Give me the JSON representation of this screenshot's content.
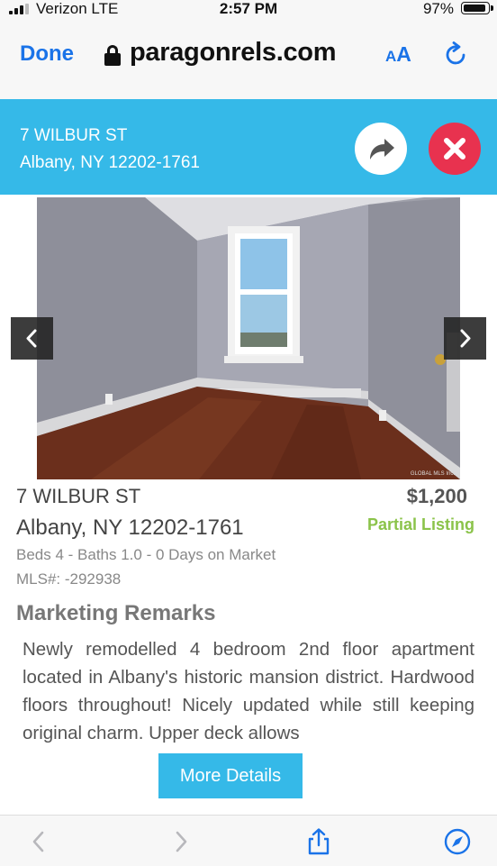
{
  "status_bar": {
    "carrier": "Verizon  LTE",
    "time": "2:57 PM",
    "battery": "97%",
    "battery_level": 0.97
  },
  "browser": {
    "done_label": "Done",
    "domain": "paragonrels.com",
    "text_size_small": "A",
    "text_size_large": "A"
  },
  "header": {
    "street": "7 WILBUR ST",
    "city_line": "Albany, NY 12202-1761"
  },
  "photo": {
    "watermark": "GLOBAL MLS Inc."
  },
  "listing": {
    "street": "7 WILBUR ST",
    "city_line": "Albany, NY 12202-1761",
    "price": "$1,200",
    "status": "Partial Listing",
    "details": "Beds 4 - Baths 1.0 - 0 Days on Market",
    "mls": "MLS#: -292938"
  },
  "remarks": {
    "title": "Marketing Remarks",
    "text": "Newly remodelled 4 bedroom 2nd floor apartment located in Albany's historic mansion district. Hardwood floors throughout! Nicely updated while still keeping original charm. Upper deck allows"
  },
  "more_details_label": "More Details",
  "colors": {
    "header_blue": "#35b9e8",
    "close_red": "#e8324f",
    "status_green": "#8bc34a",
    "link_blue": "#1a73e8"
  }
}
